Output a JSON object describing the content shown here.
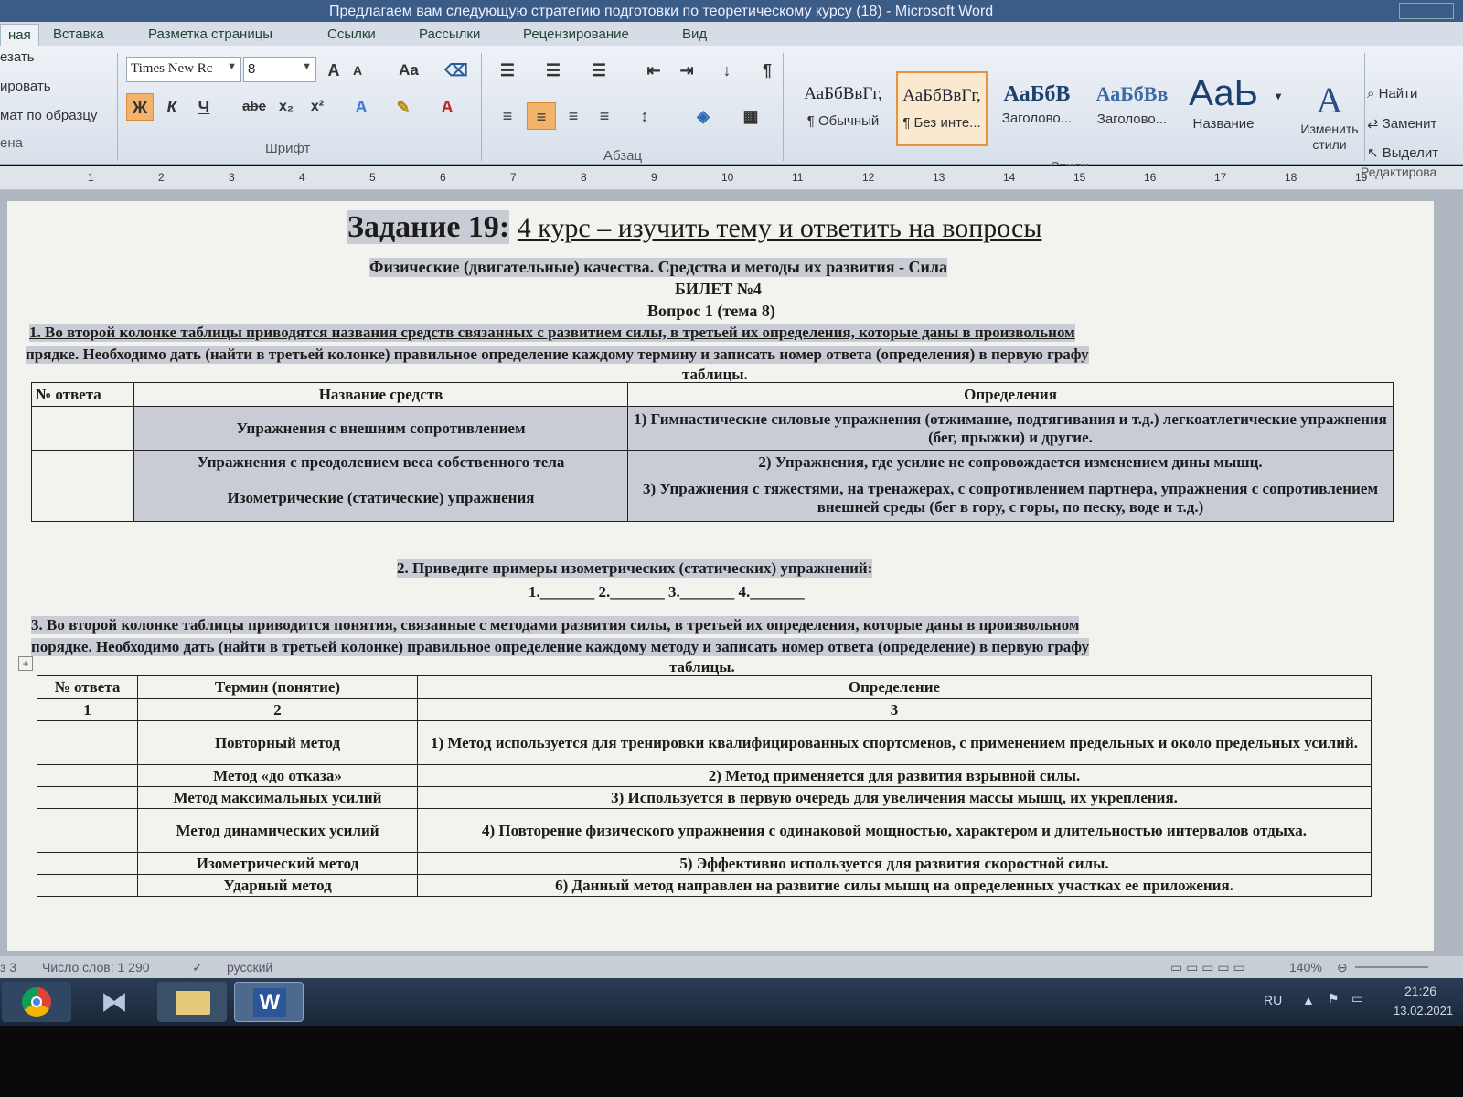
{
  "window": {
    "title": "Предлагаем вам следующую стратегию подготовки по теоретическому курсу (18) - Microsoft Word"
  },
  "ribbon": {
    "tabs": [
      {
        "label": "ная"
      },
      {
        "label": "Вставка"
      },
      {
        "label": "Разметка страницы"
      },
      {
        "label": "Ссылки"
      },
      {
        "label": "Рассылки"
      },
      {
        "label": "Рецензирование"
      },
      {
        "label": "Вид"
      }
    ],
    "clipboard": {
      "cut": "езать",
      "copy": "ировать",
      "format_painter": "мат по образцу",
      "group": "ена"
    },
    "font": {
      "name": "Times New Rc",
      "size": "8",
      "group_label": "Шрифт",
      "bold": "Ж",
      "italic": "К",
      "underline": "Ч",
      "strike": "abe",
      "subscript": "x₂",
      "superscript": "x²",
      "grow": "A",
      "shrink": "A",
      "case": "Aa"
    },
    "paragraph": {
      "group_label": "Абзац",
      "pilcrow": "¶"
    },
    "styles": {
      "group_label": "Стили",
      "items": [
        {
          "sample": "АаБбВвГг,",
          "name": "¶ Обычный"
        },
        {
          "sample": "АаБбВвГг,",
          "name": "¶ Без инте..."
        },
        {
          "sample": "АаБбВ",
          "name": "Заголово..."
        },
        {
          "sample": "АаБбВв",
          "name": "Заголово..."
        },
        {
          "sample": "АаЬ",
          "name": "Название"
        }
      ],
      "change": "Изменить стили"
    },
    "editing": {
      "find": "Найти",
      "replace": "Заменит",
      "select": "Выделит",
      "group_label": "Редактирова"
    }
  },
  "ruler": {
    "numbers": [
      "1",
      "2",
      "3",
      "4",
      "5",
      "6",
      "7",
      "8",
      "9",
      "10",
      "11",
      "12",
      "13",
      "14",
      "15",
      "16",
      "17",
      "18",
      "19"
    ]
  },
  "doc": {
    "task_label": "Задание 19:",
    "task_text": "4 курс – изучить тему и ответить на вопросы",
    "subtitle": "Физические (двигательные) качества. Средства и методы их развития - Сила",
    "ticket": "БИЛЕТ №4",
    "question": "Вопрос  1 (тема 8)",
    "q1_line1": "1.     Во второй колонке таблицы приводятся названия средств связанных с развитием силы, в третьей их определения, которые даны в произвольном",
    "q1_line2": "прядке. Необходимо дать (найти в третьей колонке)  правильное определение каждому термину и записать номер ответа (определения) в первую графу",
    "q1_line3": "таблицы.",
    "table1": {
      "headers": [
        "№ ответа",
        "Название средств",
        "Определения"
      ],
      "rows": [
        [
          "",
          "Упражнения с внешним сопротивлением",
          "1) Гимнастические силовые упражнения (отжимание, подтягивания и т.д.) легкоатлетические упражнения (бег, прыжки) и другие."
        ],
        [
          "",
          "Упражнения с преодолением веса собственного тела",
          "2) Упражнения, где усилие не сопровождается изменением дины мышц."
        ],
        [
          "",
          "Изометрические (статические) упражнения",
          "3) Упражнения с тяжестями, на тренажерах, с сопротивлением партнера, упражнения с сопротивлением внешней среды (бег в гору, с горы, по песку, воде и т.д.)"
        ]
      ]
    },
    "q2": "2.      Приведите примеры изометрических (статических) упражнений:",
    "q2_blanks": "1._______    2._______    3._______    4._______",
    "q3_line1": "3.      Во второй колонке таблицы приводится понятия, связанные с методами развития силы, в третьей их определения, которые даны в произвольном",
    "q3_line2": "порядке. Необходимо дать (найти в третьей колонке) правильное определение каждому методу и записать номер ответа (определение) в первую графу",
    "q3_line3": "таблицы.",
    "table2": {
      "headers": [
        "№ ответа",
        "Термин (понятие)",
        "Определение"
      ],
      "numbers": [
        "1",
        "2",
        "3"
      ],
      "rows": [
        [
          "",
          "Повторный метод",
          "1) Метод используется для тренировки квалифицированных спортсменов, с применением предельных и около предельных усилий."
        ],
        [
          "",
          "Метод «до отказа»",
          "2) Метод применяется для развития взрывной силы."
        ],
        [
          "",
          "Метод максимальных усилий",
          "3) Используется в первую очередь для увеличения массы мышц, их укрепления."
        ],
        [
          "",
          "Метод динамических усилий",
          "4)  Повторение физического упражнения с одинаковой мощностью, характером и длительностью интервалов отдыха."
        ],
        [
          "",
          "Изометрический метод",
          "5) Эффективно используется для развития скоростной силы."
        ],
        [
          "",
          "Ударный метод",
          "6) Данный метод направлен на развитие силы мышц на определенных участках ее приложения."
        ]
      ]
    }
  },
  "status": {
    "page": "з 3",
    "words": "Число слов: 1 290",
    "language": "русский",
    "zoom": "140%"
  },
  "taskbar": {
    "lang": "RU",
    "time": "21:26",
    "date": "13.02.2021",
    "word_label": "W"
  }
}
